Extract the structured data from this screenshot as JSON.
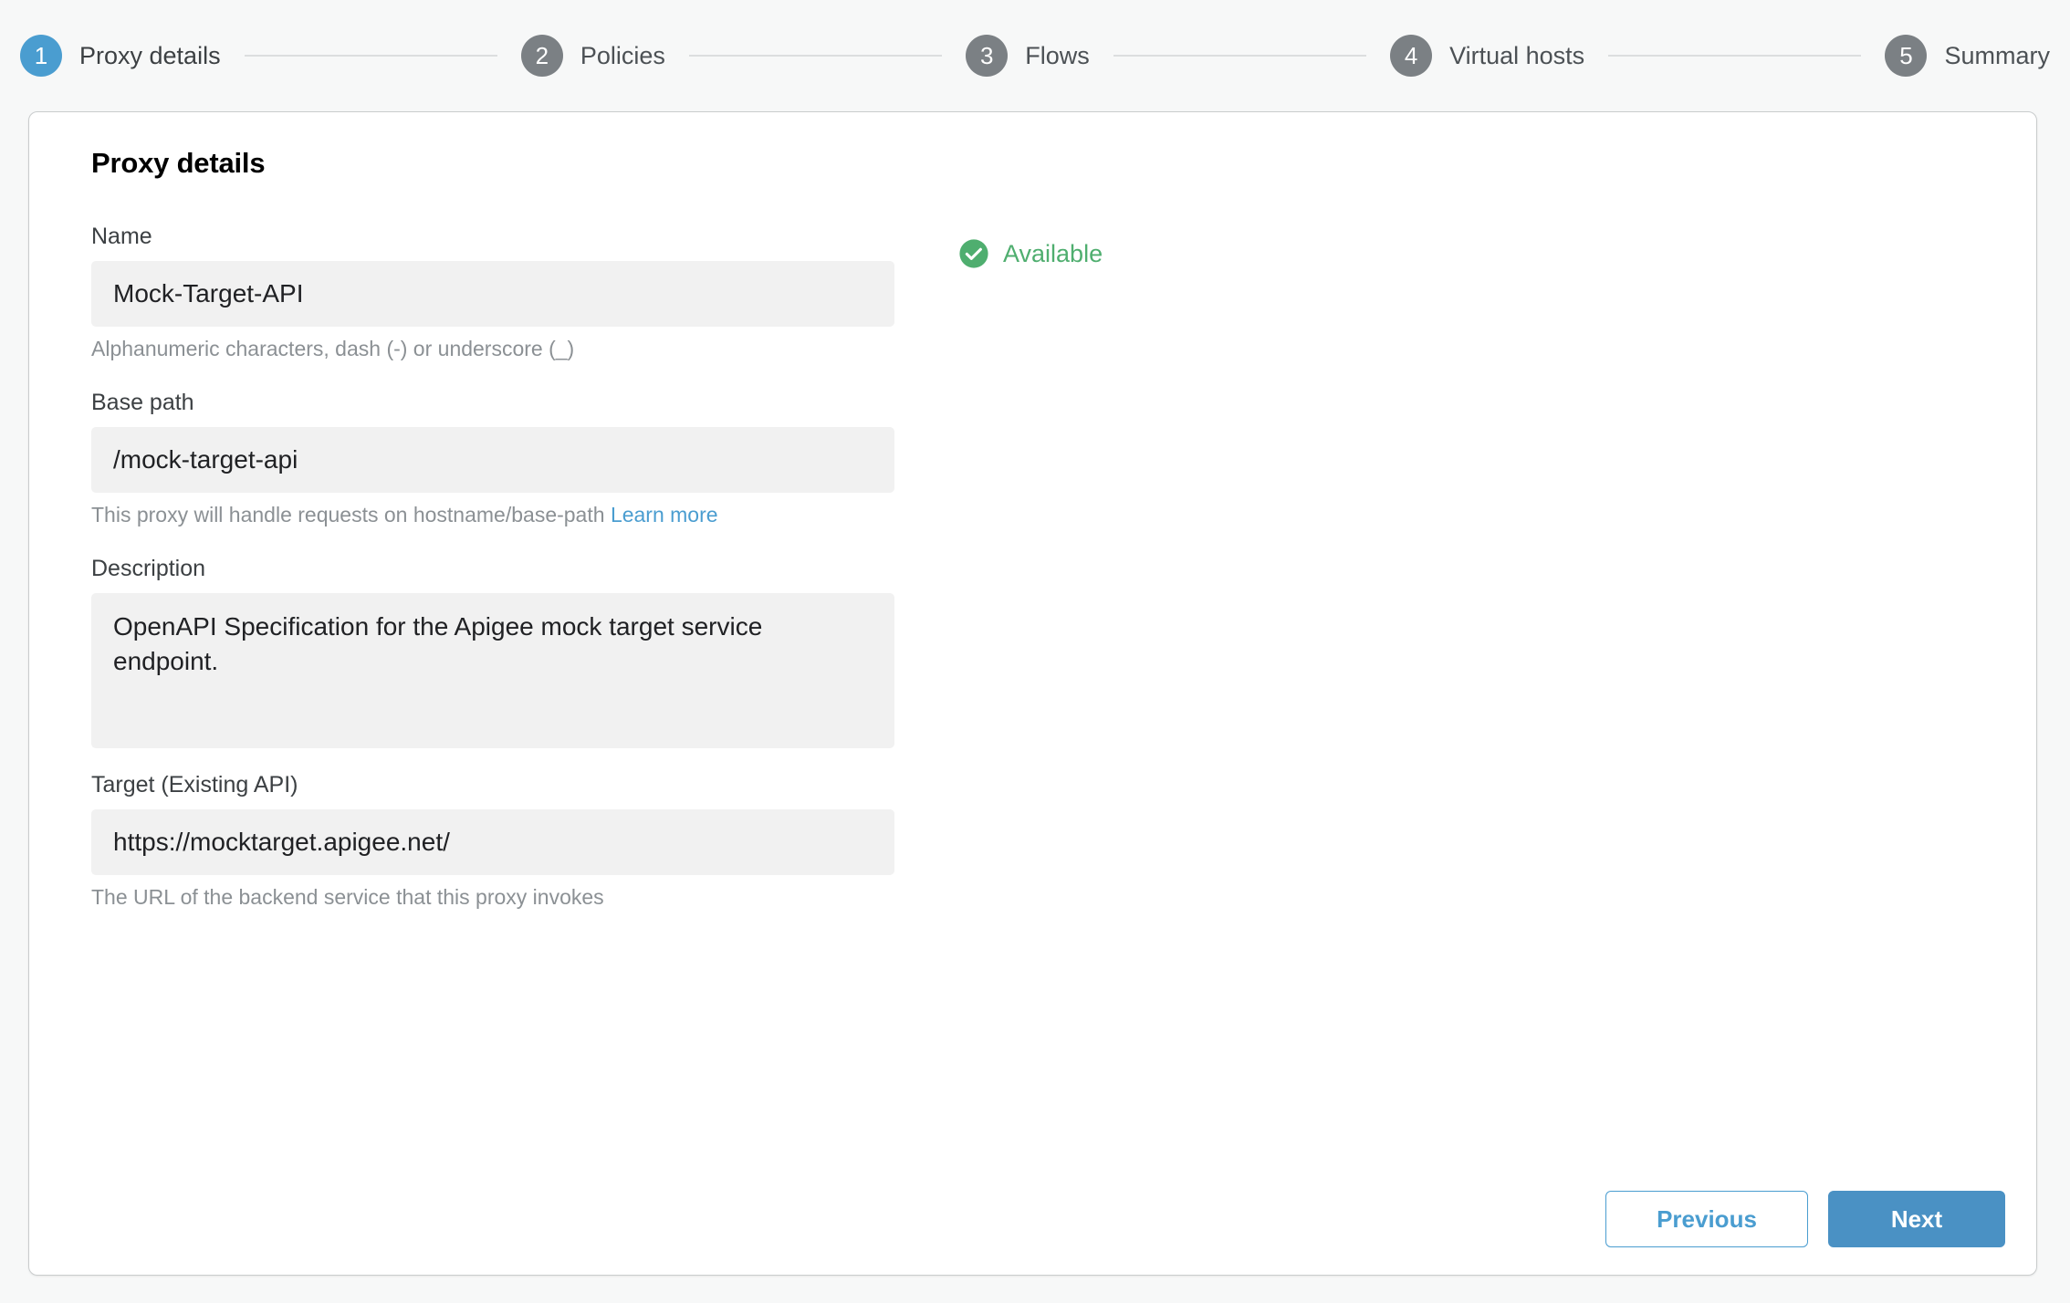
{
  "stepper": {
    "steps": [
      {
        "number": "1",
        "label": "Proxy details",
        "active": true
      },
      {
        "number": "2",
        "label": "Policies",
        "active": false
      },
      {
        "number": "3",
        "label": "Flows",
        "active": false
      },
      {
        "number": "4",
        "label": "Virtual hosts",
        "active": false
      },
      {
        "number": "5",
        "label": "Summary",
        "active": false
      }
    ]
  },
  "card": {
    "title": "Proxy details"
  },
  "fields": {
    "name": {
      "label": "Name",
      "value": "Mock-Target-API",
      "placeholder": "",
      "help": "Alphanumeric characters, dash (-) or underscore (_)"
    },
    "base_path": {
      "label": "Base path",
      "value": "/mock-target-api",
      "placeholder": "",
      "help_prefix": "This proxy will handle requests on hostname/base-path",
      "help_link": "Learn more"
    },
    "description": {
      "label": "Description",
      "value": "OpenAPI Specification for the Apigee mock target service endpoint.",
      "placeholder": ""
    },
    "target": {
      "label": "Target (Existing API)",
      "value": "https://mocktarget.apigee.net/",
      "placeholder": "",
      "help": "The URL of the backend service that this proxy invokes"
    }
  },
  "availability": {
    "icon": "check-circle-icon",
    "text": "Available"
  },
  "footer": {
    "previous_label": "Previous",
    "next_label": "Next"
  },
  "colors": {
    "accent_blue": "#4a9dd0",
    "primary_button": "#4a91c4",
    "step_inactive": "#7b8084",
    "success_green": "#4fae6f",
    "page_background": "#f7f8f8",
    "field_background": "#f1f1f1",
    "help_text": "#8b9094"
  }
}
